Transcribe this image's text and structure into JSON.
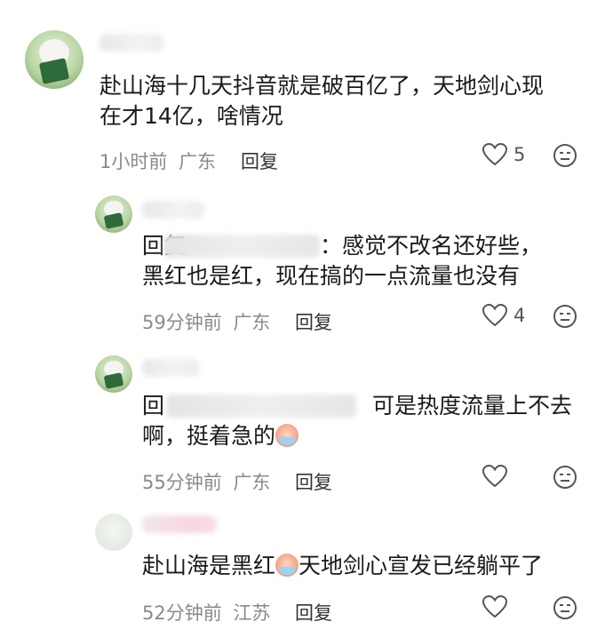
{
  "comments": [
    {
      "text_line1": "赴山海十几天抖音就是破百亿了，天地剑心现",
      "text_line2": "在才14亿，啥情况",
      "time": "1小时前",
      "location": "广东",
      "reply_label": "回复",
      "likes": "5"
    },
    {
      "reply_prefix": "回复",
      "text_after_blur": "：感觉不改名还好些，",
      "text_line2": "黑红也是红，现在搞的一点流量也没有",
      "time": "59分钟前",
      "location": "广东",
      "reply_label": "回复",
      "likes": "4"
    },
    {
      "reply_prefix": "回",
      "text_after_blur": "可是热度流量上不去",
      "text_line2": "啊，挺着急的",
      "emoji": "crying-emoji",
      "time": "55分钟前",
      "location": "广东",
      "reply_label": "回复",
      "likes": ""
    },
    {
      "text_part1": "赴山海是黑红",
      "emoji": "crying-emoji",
      "text_part2": "天地剑心宣发已经躺平了",
      "time": "52分钟前",
      "location": "江苏",
      "reply_label": "回复",
      "likes": ""
    }
  ],
  "icons": {
    "like": "heart-outline-icon",
    "dislike": "unhappy-face-icon"
  },
  "colors": {
    "text": "#1a1a1a",
    "meta": "#8a8a8a",
    "icon": "#555555"
  }
}
